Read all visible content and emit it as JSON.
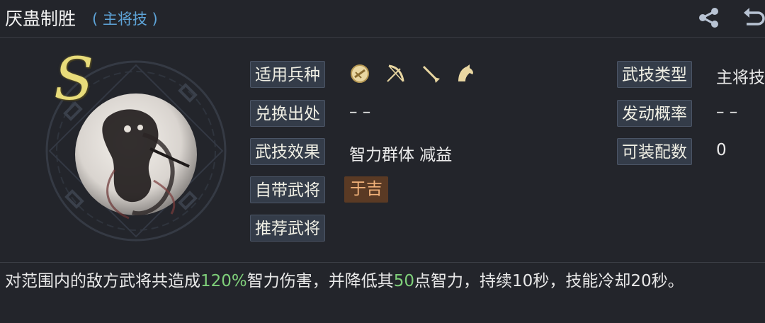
{
  "header": {
    "title": "厌蛊制胜",
    "subtitle": "( 主将技 )",
    "share_icon": "share-icon",
    "back_icon": "return-icon"
  },
  "skill": {
    "grade": "S",
    "icon": "skill-emblem-ink-ghost"
  },
  "info_left": [
    {
      "label": "适用兵种",
      "value": ""
    },
    {
      "label": "兑换出处",
      "value": "– –"
    },
    {
      "label": "武技效果",
      "value": "智力群体 减益"
    },
    {
      "label": "自带武将",
      "value": "于吉"
    },
    {
      "label": "推荐武将",
      "value": ""
    }
  ],
  "troops": [
    "shield-icon",
    "bow-icon",
    "spear-icon",
    "horse-icon"
  ],
  "info_right": [
    {
      "label": "武技类型",
      "value": "主将技"
    },
    {
      "label": "发动概率",
      "value": "– –"
    },
    {
      "label": "可装配数",
      "value": "0"
    }
  ],
  "description": {
    "p1": "对范围内的敌方武将共造成",
    "v1": "120%",
    "p2": "智力伤害，并降低其",
    "v2": "50",
    "p3": "点智力，持续10秒，技能冷却20秒。"
  },
  "colors": {
    "background": "#23252b",
    "accent_blue": "#5ea4d8",
    "highlight_green": "#7fd07a",
    "grade_gold": "#e8dc7a",
    "hero_chip": "#5a3a24"
  }
}
